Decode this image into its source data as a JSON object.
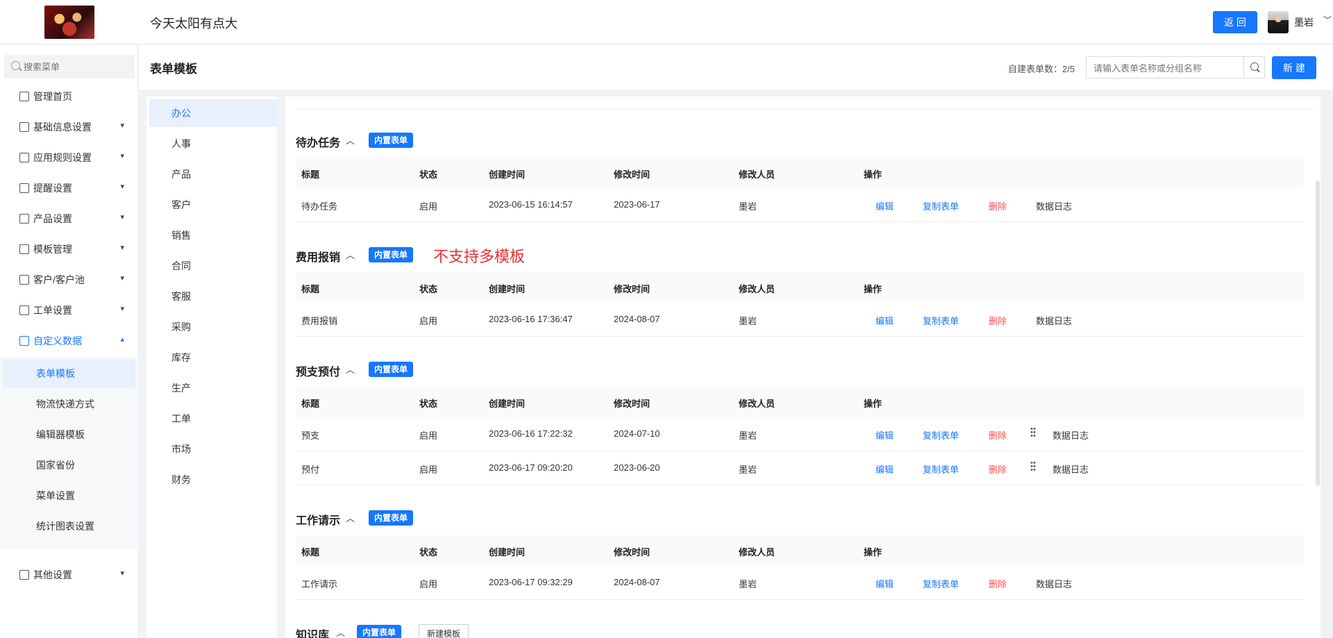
{
  "header": {
    "site_title": "今天太阳有点大",
    "back_label": "返 回",
    "user_name": "墨岩",
    "user_chevron": "﹀"
  },
  "sidebar": {
    "search_placeholder": "搜索菜单",
    "items": [
      {
        "label": "管理首页",
        "icon": "home-icon"
      },
      {
        "label": "基础信息设置",
        "icon": "cube-icon"
      },
      {
        "label": "应用规则设置",
        "icon": "document-icon"
      },
      {
        "label": "提醒设置",
        "icon": "bell-icon"
      },
      {
        "label": "产品设置",
        "icon": "box-icon"
      },
      {
        "label": "模板管理",
        "icon": "template-icon"
      },
      {
        "label": "客户/客户池",
        "icon": "users-icon"
      },
      {
        "label": "工单设置",
        "icon": "ticket-icon"
      },
      {
        "label": "自定义数据",
        "icon": "custom-data-icon"
      },
      {
        "label": "其他设置",
        "icon": "grid-icon"
      }
    ],
    "sub_items": [
      "表单模板",
      "物流快递方式",
      "编辑器模板",
      "国家省份",
      "菜单设置",
      "统计图表设置"
    ],
    "chevron_down": "▾",
    "chevron_up": "▴"
  },
  "page": {
    "title": "表单模板",
    "quota_text": "自建表单数：2/5",
    "search_placeholder": "请输入表单名称或分组名称",
    "new_label": "新 建"
  },
  "categories": [
    "办公",
    "人事",
    "产品",
    "客户",
    "销售",
    "合同",
    "客服",
    "采购",
    "库存",
    "生产",
    "工单",
    "市场",
    "财务"
  ],
  "table": {
    "headers": [
      "标题",
      "状态",
      "创建时间",
      "修改时间",
      "修改人员",
      "操作"
    ],
    "actions": {
      "edit": "编辑",
      "copy": "复制表单",
      "delete": "删除",
      "log": "数据日志"
    }
  },
  "tag_label": "内置表单",
  "caret": "︿",
  "note": "不支持多模板",
  "sections": [
    {
      "title": "待办任务",
      "rows": [
        {
          "title": "待办任务",
          "status": "启用",
          "created": "2023-06-15 16:14:57",
          "modified": "2023-06-17",
          "modifier": "墨岩"
        }
      ]
    },
    {
      "title": "费用报销",
      "rows": [
        {
          "title": "费用报销",
          "status": "启用",
          "created": "2023-06-16 17:36:47",
          "modified": "2024-08-07",
          "modifier": "墨岩"
        }
      ]
    },
    {
      "title": "预支预付",
      "rows": [
        {
          "title": "预支",
          "status": "启用",
          "created": "2023-06-16 17:22:32",
          "modified": "2024-07-10",
          "modifier": "墨岩"
        },
        {
          "title": "预付",
          "status": "启用",
          "created": "2023-06-17 09:20:20",
          "modified": "2023-06-20",
          "modifier": "墨岩"
        }
      ]
    },
    {
      "title": "工作请示",
      "rows": [
        {
          "title": "工作请示",
          "status": "启用",
          "created": "2023-06-17 09:32:29",
          "modified": "2024-08-07",
          "modifier": "墨岩"
        }
      ]
    },
    {
      "title": "知识库",
      "rows": []
    }
  ],
  "new_template_label": "新建模板",
  "colors": {
    "primary": "#1677ff",
    "danger": "#ff4d4f",
    "note": "#e5302f"
  }
}
